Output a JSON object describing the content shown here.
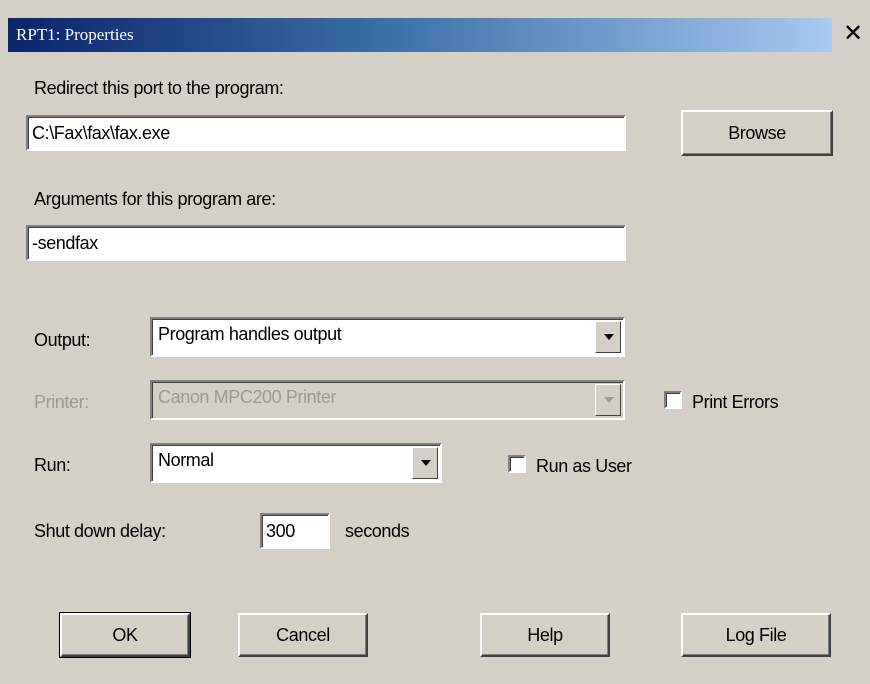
{
  "window": {
    "title": "RPT1: Properties",
    "close_glyph": "✕"
  },
  "redirect": {
    "label": "Redirect this port to the program:",
    "value": "C:\\Fax\\fax\\fax.exe",
    "browse_label": "Browse"
  },
  "arguments": {
    "label": "Arguments for this program are:",
    "value": "-sendfax"
  },
  "output": {
    "label": "Output:",
    "selected": "Program handles output"
  },
  "printer": {
    "label": "Printer:",
    "selected": "Canon MPC200 Printer",
    "enabled": false
  },
  "print_errors": {
    "label": "Print Errors",
    "checked": false
  },
  "run": {
    "label": "Run:",
    "selected": "Normal"
  },
  "run_as_user": {
    "label": "Run as User",
    "checked": false
  },
  "shutdown": {
    "label": "Shut down delay:",
    "value": "300",
    "unit": "seconds"
  },
  "buttons": {
    "ok": "OK",
    "cancel": "Cancel",
    "help": "Help",
    "log_file": "Log File"
  },
  "colors": {
    "titlebar_start": "#0a246a",
    "titlebar_end": "#a6caf0",
    "dialog_bg": "#d4d0c8",
    "disabled_text": "#9c9a94"
  }
}
